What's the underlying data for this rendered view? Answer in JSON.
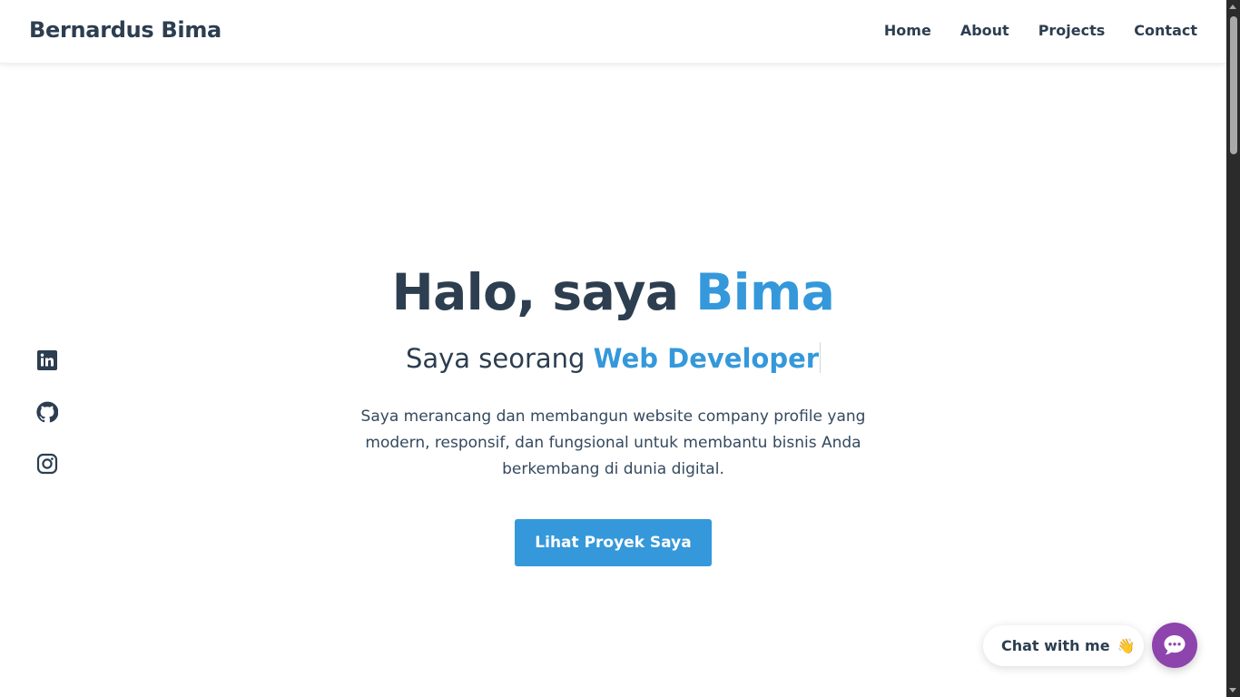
{
  "header": {
    "brand": "Bernardus Bima",
    "nav": [
      {
        "label": "Home"
      },
      {
        "label": "About"
      },
      {
        "label": "Projects"
      },
      {
        "label": "Contact"
      }
    ]
  },
  "social": [
    {
      "icon": "linkedin-icon"
    },
    {
      "icon": "github-icon"
    },
    {
      "icon": "instagram-icon"
    }
  ],
  "hero": {
    "greeting": "Halo, saya ",
    "name": "Bima",
    "subtitle_prefix": "Saya seorang ",
    "role": "Web Developer",
    "description": "Saya merancang dan membangun website company profile yang modern, responsif, dan fungsional untuk membantu bisnis Anda berkembang di dunia digital.",
    "cta_label": "Lihat Proyek Saya"
  },
  "chat": {
    "label": "Chat with me",
    "emoji": "👋",
    "button_icon": "chat-bubble-icon"
  },
  "colors": {
    "text": "#2c3e50",
    "accent": "#3498db",
    "chat_button": "#8e44ad"
  }
}
